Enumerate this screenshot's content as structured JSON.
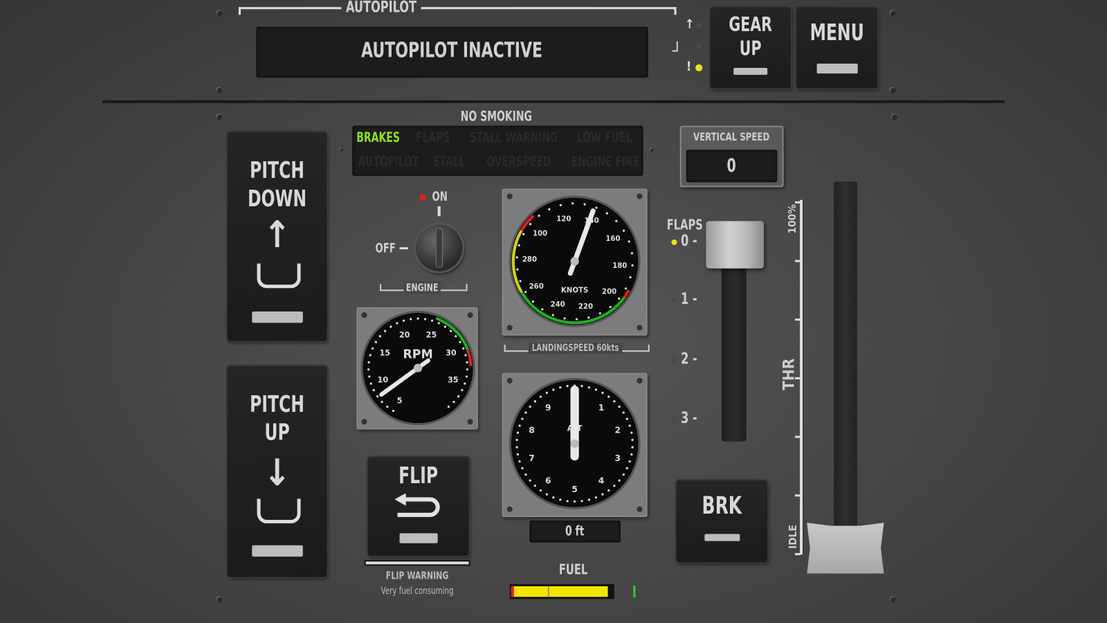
{
  "autopilot": {
    "title": "AUTOPILOT",
    "status": "AUTOPILOT INACTIVE"
  },
  "gear": {
    "label_line1": "GEAR",
    "label_line2": "UP",
    "state": "down",
    "indicator_color": "#f0e020"
  },
  "menu": {
    "label": "MENU"
  },
  "no_smoking": "NO SMOKING",
  "warnings": {
    "active_color": "#8ee020",
    "items": [
      {
        "label": "BRAKES",
        "active": true
      },
      {
        "label": "FLAPS",
        "active": false
      },
      {
        "label": "STALL WARNING",
        "active": false
      },
      {
        "label": "LOW FUEL",
        "active": false
      },
      {
        "label": "AUTOPILOT",
        "active": false
      },
      {
        "label": "STALL",
        "active": false
      },
      {
        "label": "OVERSPEED",
        "active": false
      },
      {
        "label": "ENGINE FIRE",
        "active": false
      }
    ]
  },
  "pitch_down": {
    "line1": "PITCH",
    "line2": "DOWN",
    "arrow": "↑"
  },
  "pitch_up": {
    "line1": "PITCH",
    "line2": "UP",
    "arrow": "↓"
  },
  "engine": {
    "on_label": "ON",
    "off_label": "OFF",
    "label": "ENGINE",
    "state": "on",
    "on_light_color": "#e02020"
  },
  "rpm_gauge": {
    "label": "RPM",
    "ticks": [
      "5",
      "10",
      "15",
      "20",
      "25",
      "30",
      "35"
    ],
    "value_fraction": 0.05
  },
  "airspeed_gauge": {
    "label": "KNOTS",
    "ticks": [
      "100",
      "120",
      "140",
      "160",
      "180",
      "200",
      "220",
      "240",
      "260",
      "280"
    ],
    "caption": "LANDINGSPEED 60kts",
    "value_fraction": 0.0
  },
  "altimeter": {
    "label": "ALT",
    "ticks": [
      "0",
      "1",
      "2",
      "3",
      "4",
      "5",
      "6",
      "7",
      "8",
      "9"
    ],
    "readout": "0 ft"
  },
  "flip": {
    "label": "FLIP",
    "icon": "u-turn-arrow-icon",
    "warning_title": "FLIP WARNING",
    "warning_text": "Very fuel consuming"
  },
  "fuel": {
    "label": "FUEL",
    "level": 0.95,
    "color": "#f2e600"
  },
  "vertical_speed": {
    "label": "VERTICAL SPEED",
    "value": "0"
  },
  "flaps": {
    "label": "FLAPS",
    "positions": [
      "0",
      "1",
      "2",
      "3"
    ],
    "selected": 0
  },
  "brake": {
    "label": "BRK"
  },
  "throttle": {
    "label": "THR",
    "max_label": "100%",
    "min_label": "IDLE",
    "level": 0.0
  }
}
